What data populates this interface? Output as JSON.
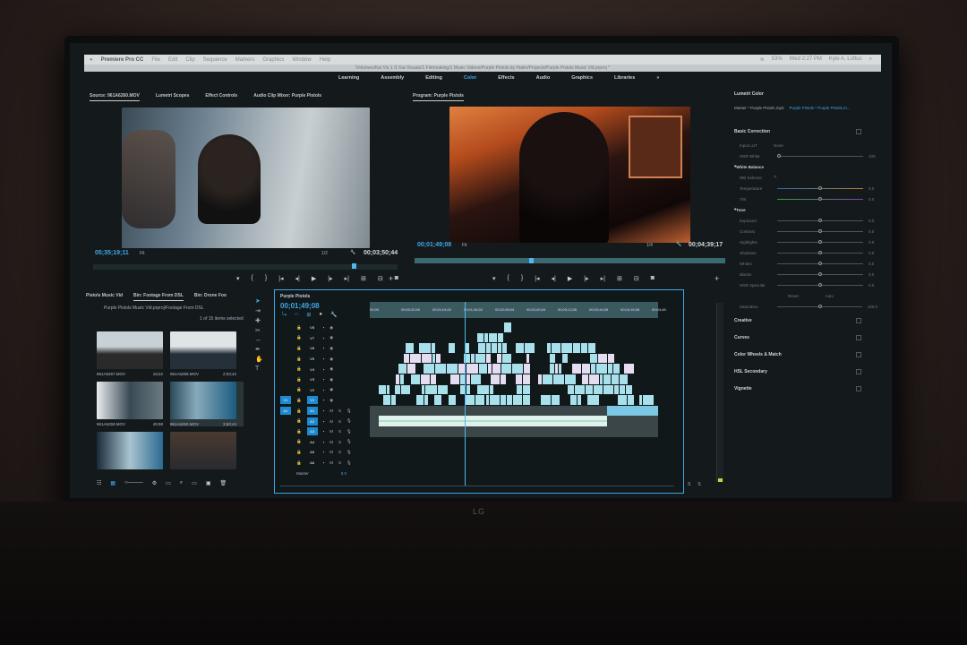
{
  "menubar": {
    "app": "Premiere Pro CC",
    "items": [
      "File",
      "Edit",
      "Clip",
      "Sequence",
      "Markers",
      "Graphics",
      "Window",
      "Help"
    ],
    "battery": "53%",
    "clock": "Wed 2:27 PM",
    "user": "Kyle A. Loftus"
  },
  "path": "/Volumes/Kai Vis 1 /1 Kai Visuals/1 Filmmaking/1 Music Videos/Purple Pistols by Halim/Projects/Purple Pistols Music Vid.prproj *",
  "workspaces": {
    "items": [
      "Learning",
      "Assembly",
      "Editing",
      "Color",
      "Effects",
      "Audio",
      "Graphics",
      "Libraries"
    ],
    "active": "Color",
    "more": "»"
  },
  "source": {
    "tabs": [
      "Source: 961A6260.MOV",
      "Lumetri Scopes",
      "Effect Controls",
      "Audio Clip Mixer: Purple Pistols"
    ],
    "timecode": "05;35;19;11",
    "fit": "Fit",
    "resolution": "1/2",
    "duration": "00;03;50;44",
    "playhead": 0.85
  },
  "program": {
    "title": "Program: Purple Pistols",
    "timecode": "00;01;49;08",
    "fit": "Fit",
    "resolution": "1/4",
    "duration": "00;04;39;17",
    "playhead": 0.37
  },
  "transport": [
    "▾",
    "{",
    "}",
    "|◂",
    "◂|",
    "▶",
    "|▸",
    "▸|",
    "⊞",
    "⊟",
    "◙"
  ],
  "lumetri": {
    "title": "Lumetri Color",
    "master": "Master * Purple Pistols.mp3",
    "clip": "Purple Pistols * Purple Pistols.m...",
    "basic": "Basic Correction",
    "input_lut_label": "Input LUT",
    "input_lut": "None",
    "hdr_white": "HDR White",
    "hdr_white_val": "100",
    "white_balance": "White Balance",
    "wb_selector": "WB Selector",
    "wb_rows": [
      {
        "label": "Temperature",
        "value": "0.0",
        "level": 0.5
      },
      {
        "label": "Tint",
        "value": "0.0",
        "level": 0.5
      }
    ],
    "tone": "Tone",
    "tone_rows": [
      {
        "label": "Exposure",
        "value": "0.0",
        "level": 0.5
      },
      {
        "label": "Contrast",
        "value": "0.0",
        "level": 0.5
      },
      {
        "label": "Highlights",
        "value": "0.0",
        "level": 0.5
      },
      {
        "label": "Shadows",
        "value": "0.0",
        "level": 0.5
      },
      {
        "label": "Whites",
        "value": "0.0",
        "level": 0.5
      },
      {
        "label": "Blacks",
        "value": "0.0",
        "level": 0.5
      },
      {
        "label": "HDR Specular",
        "value": "0.0",
        "level": 0.5
      }
    ],
    "reset": "Reset",
    "auto": "Auto",
    "saturation": "Saturation",
    "saturation_val": "100.0",
    "sections": [
      "Creative",
      "Curves",
      "Color Wheels & Match",
      "HSL Secondary",
      "Vignette"
    ]
  },
  "project": {
    "tabs": [
      "Pistols Music Vid",
      "Bin: Footage From DSL",
      "Bin: Drone Foo"
    ],
    "path": "Purple Pistols Music Vid.prproj\\Footage From DSL",
    "selected": "1 of 15 items selected",
    "clips": [
      {
        "name": "961A6257.MOV",
        "dur": "19;22"
      },
      {
        "name": "961A6258.MOV",
        "dur": "2;03;42"
      },
      {
        "name": "961A6259.MOV",
        "dur": "49;58"
      },
      {
        "name": "961A6260.MOV",
        "dur": "3;50;44"
      },
      {
        "name": "",
        "dur": ""
      },
      {
        "name": "",
        "dur": ""
      }
    ]
  },
  "timeline": {
    "title": "Purple Pistols",
    "timecode": "00;01;49;08",
    "ruler": [
      "00;00",
      "00;00;32;00",
      "00;01;04;02",
      "00;01;36;02",
      "00;02;08;04",
      "00;02;40;04",
      "00;03;12;06",
      "00;03;44;06",
      "00;04;16;08",
      "00;04;48"
    ],
    "video_tracks": [
      "V8",
      "V7",
      "V6",
      "V5",
      "V4",
      "V3",
      "V2",
      "V1"
    ],
    "audio_tracks": [
      "A1",
      "A2",
      "A3",
      "A4",
      "A5",
      "A6"
    ],
    "master": "Master",
    "master_val": "0.0",
    "playhead": 0.33
  },
  "meters": {
    "labels": [
      "S",
      "S"
    ]
  },
  "monitor_brand": "LG"
}
